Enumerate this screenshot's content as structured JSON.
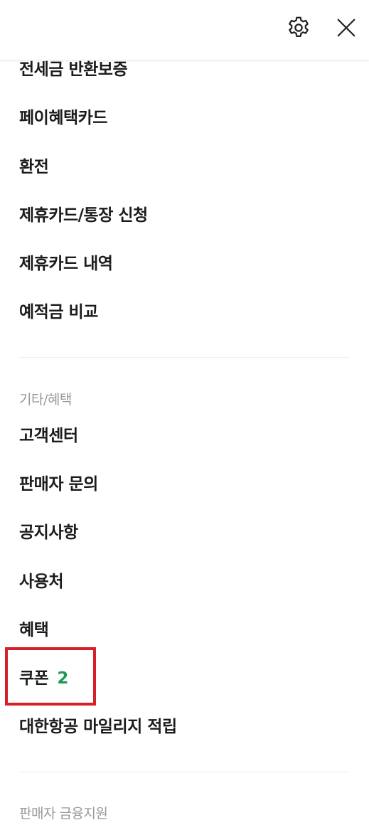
{
  "header": {
    "settings_icon": "gear-icon",
    "close_icon": "close-icon"
  },
  "menu_group_1": {
    "items": [
      {
        "label": "전세금 반환보증"
      },
      {
        "label": "페이혜택카드"
      },
      {
        "label": "환전"
      },
      {
        "label": "제휴카드/통장 신청"
      },
      {
        "label": "제휴카드 내역"
      },
      {
        "label": "예적금 비교"
      }
    ]
  },
  "section_etc": {
    "title": "기타/혜택",
    "items": [
      {
        "label": "고객센터"
      },
      {
        "label": "판매자 문의"
      },
      {
        "label": "공지사항"
      },
      {
        "label": "사용처"
      },
      {
        "label": "혜택"
      },
      {
        "label": "쿠폰",
        "count": "2"
      },
      {
        "label": "대한항공 마일리지 적립"
      }
    ]
  },
  "section_seller": {
    "title": "판매자 금융지원"
  },
  "colors": {
    "coupon_count": "#1c9a52",
    "highlight": "#d61f26",
    "section_title": "#9a9a9a"
  }
}
